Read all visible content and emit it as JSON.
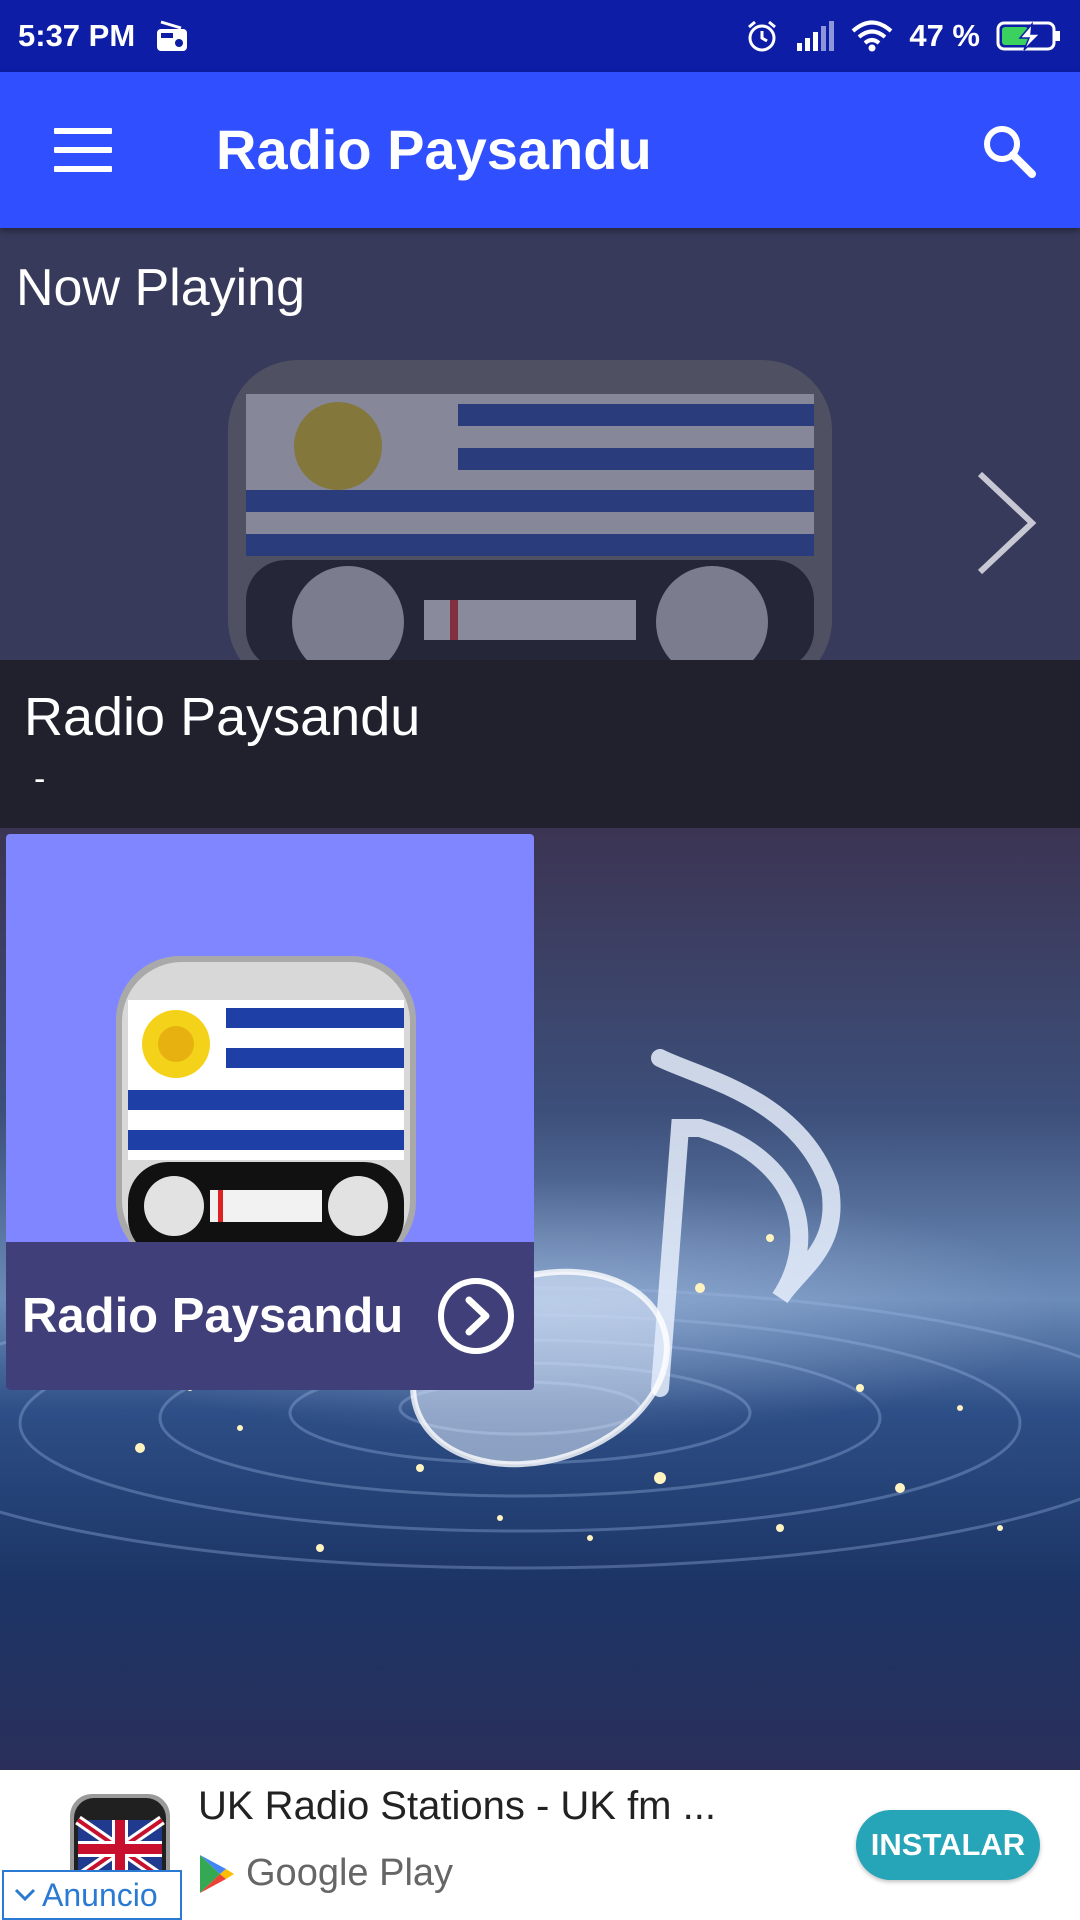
{
  "status_bar": {
    "time": "5:37 PM",
    "battery": "47 %",
    "icons": [
      "radio-icon",
      "alarm-icon",
      "signal-icon",
      "wifi-icon",
      "battery-charging-icon"
    ]
  },
  "app_bar": {
    "title": "Radio Paysandu",
    "icons": [
      "menu-icon",
      "search-icon"
    ]
  },
  "now_playing": {
    "label": "Now Playing",
    "station": "Radio Paysandu",
    "track": "-"
  },
  "station_card": {
    "title": "Radio Paysandu"
  },
  "ad": {
    "title": "UK Radio Stations - UK fm ...",
    "store": "Google Play",
    "install": "INSTALAR",
    "badge": "Anuncio"
  },
  "colors": {
    "status_bar": "#0d1da6",
    "app_bar": "#304ffe",
    "card": "#7f86ff",
    "card_footer": "#403f79",
    "install_button": "#26a5b8"
  }
}
